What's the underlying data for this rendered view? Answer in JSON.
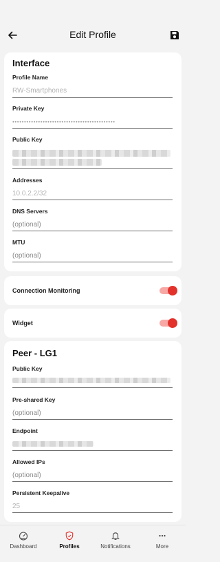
{
  "header": {
    "title": "Edit Profile",
    "back_icon": "arrow-left-icon",
    "save_icon": "save-icon"
  },
  "interface": {
    "section_title": "Interface",
    "profile_name": {
      "label": "Profile Name",
      "value": "RW-Smartphones"
    },
    "private_key": {
      "label": "Private Key",
      "value": "••••••••••••••••••••••••••••••••••••••••••••"
    },
    "public_key": {
      "label": "Public Key"
    },
    "addresses": {
      "label": "Addresses",
      "value": "10.0.2.2/32"
    },
    "dns_servers": {
      "label": "DNS Servers",
      "placeholder": "(optional)"
    },
    "mtu": {
      "label": "MTU",
      "placeholder": "(optional)"
    }
  },
  "connection_monitoring": {
    "label": "Connection Monitoring",
    "enabled": true
  },
  "widget": {
    "label": "Widget",
    "enabled": true
  },
  "peer": {
    "section_title": "Peer - LG1",
    "public_key": {
      "label": "Public Key"
    },
    "preshared_key": {
      "label": "Pre-shared Key",
      "placeholder": "(optional)"
    },
    "endpoint": {
      "label": "Endpoint"
    },
    "allowed_ips": {
      "label": "Allowed IPs",
      "placeholder": "(optional)"
    },
    "persistent_keepalive": {
      "label": "Persistent Keepalive",
      "value": "25"
    }
  },
  "bottom_nav": {
    "items": [
      {
        "label": "Dashboard",
        "icon": "dashboard-gauge-icon",
        "active": false
      },
      {
        "label": "Profiles",
        "icon": "shield-icon",
        "active": true
      },
      {
        "label": "Notifications",
        "icon": "bell-icon",
        "active": false
      },
      {
        "label": "More",
        "icon": "more-dots-icon",
        "active": false
      }
    ]
  },
  "colors": {
    "accent": "#e3312b",
    "accent_track": "#f7a8a5",
    "background": "#f3f3f3",
    "card": "#ffffff"
  }
}
